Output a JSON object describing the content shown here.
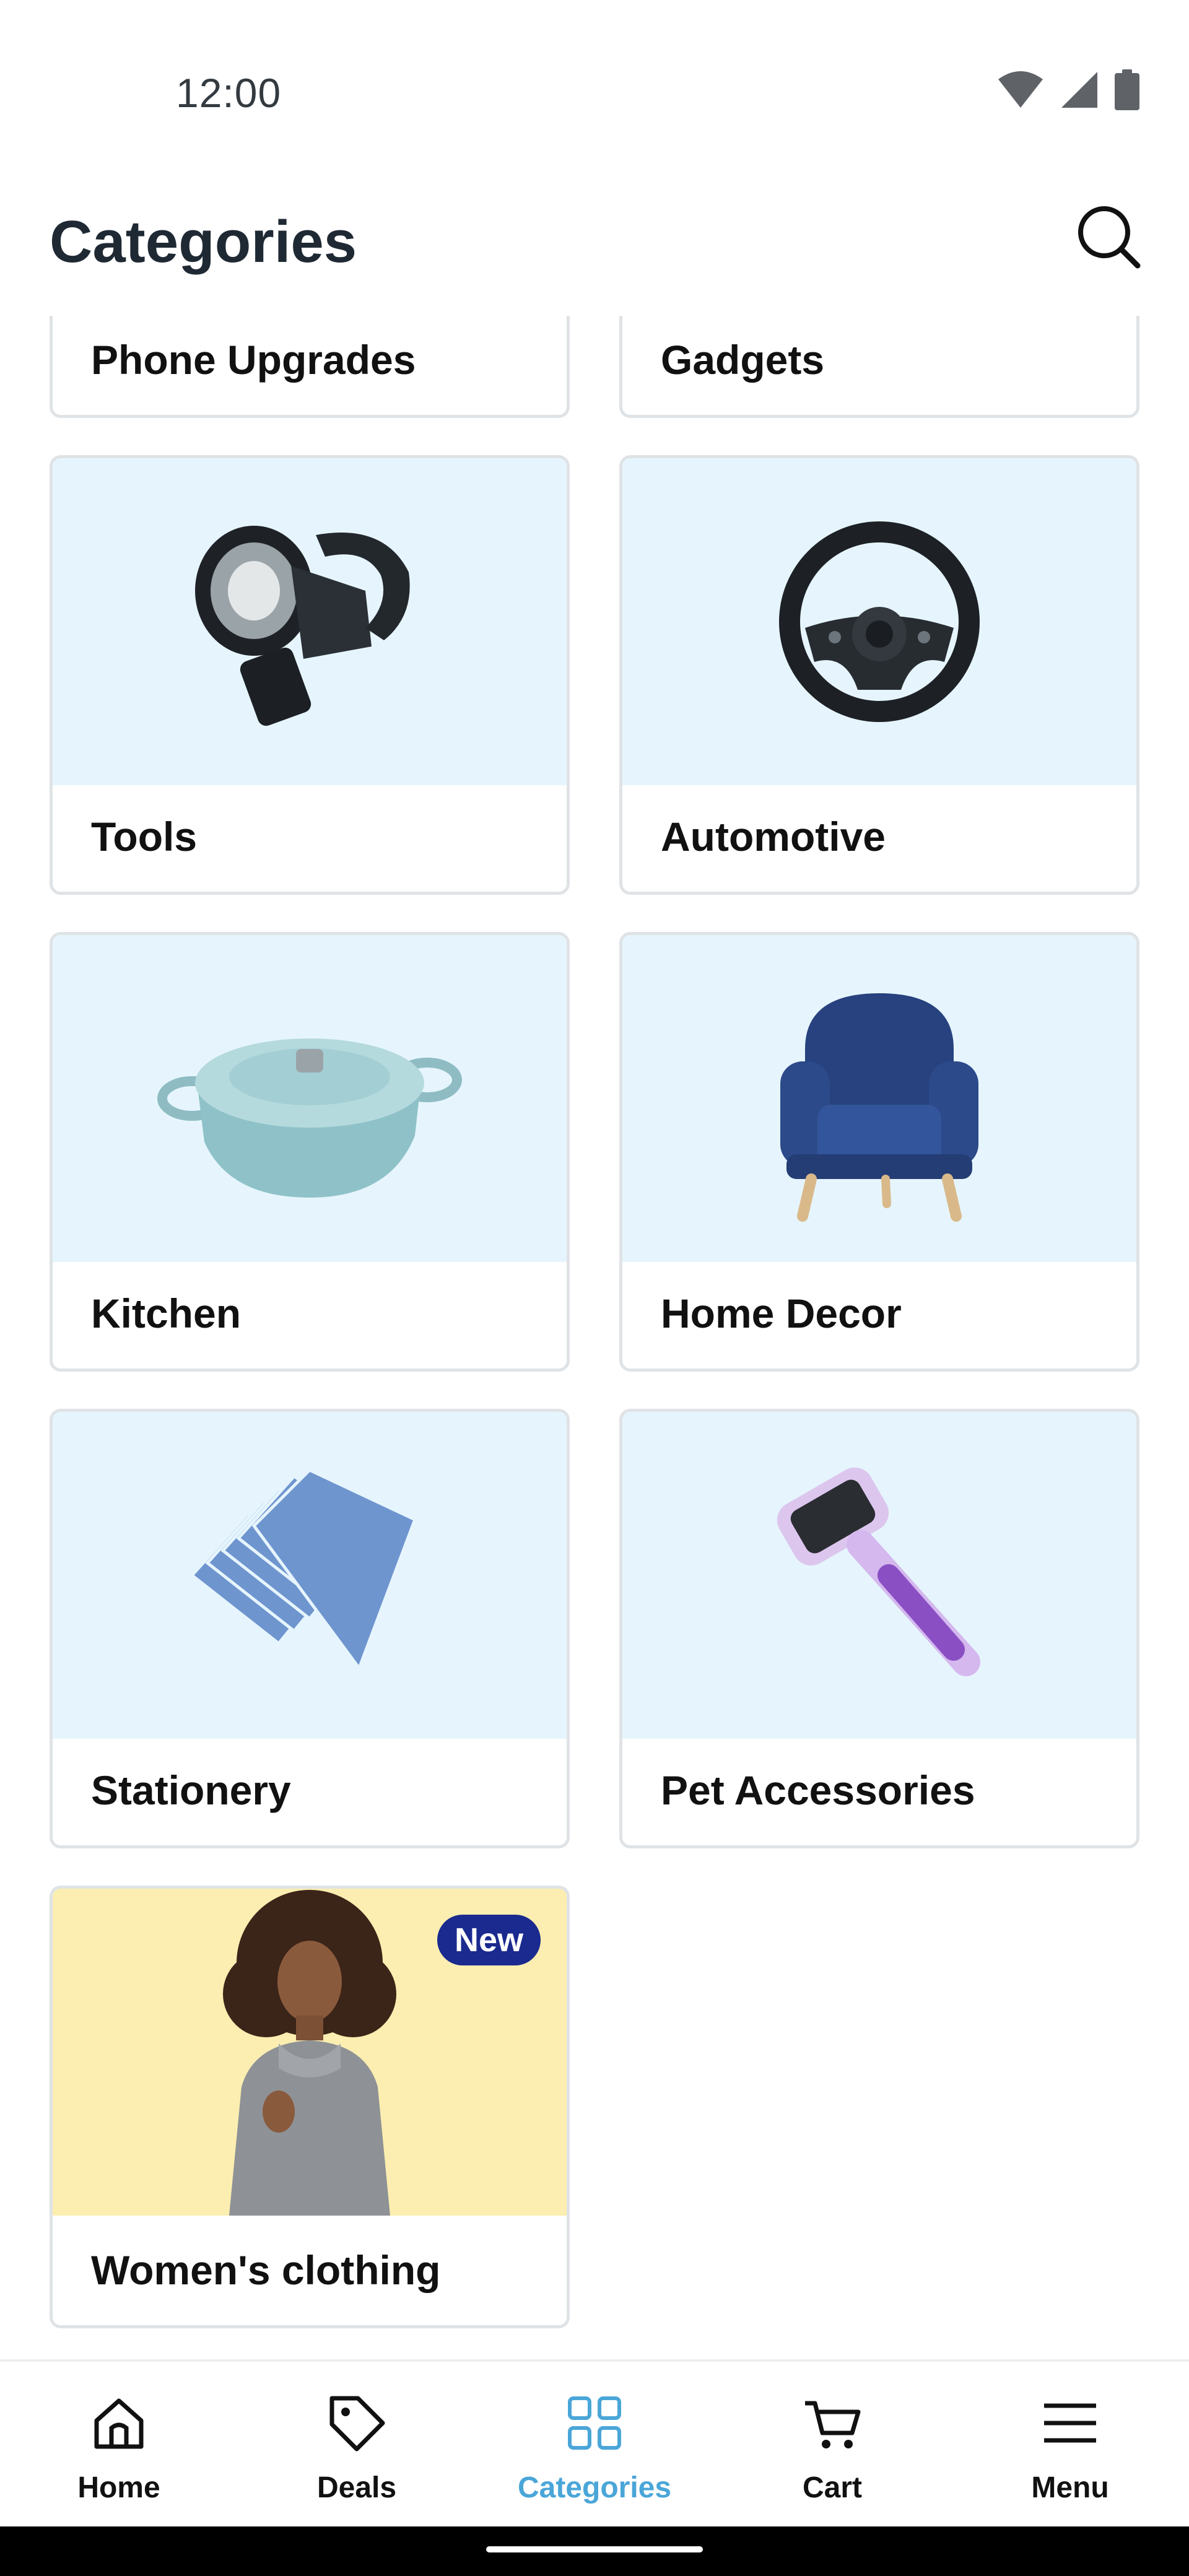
{
  "status_bar": {
    "time": "12:00",
    "icons": [
      "wifi-icon",
      "cellular-signal-icon",
      "battery-icon"
    ]
  },
  "header": {
    "title": "Categories",
    "search_icon": "search-icon"
  },
  "categories": [
    {
      "name": "Phone Upgrades",
      "image": "phone-upgrades-image"
    },
    {
      "name": "Gadgets",
      "image": "gadgets-image"
    },
    {
      "name": "Tools",
      "image": "flashlight-image"
    },
    {
      "name": "Automotive",
      "image": "steering-wheel-image"
    },
    {
      "name": "Kitchen",
      "image": "cooking-pot-image"
    },
    {
      "name": "Home Decor",
      "image": "armchair-image"
    },
    {
      "name": "Stationery",
      "image": "notebooks-image"
    },
    {
      "name": "Pet Accessories",
      "image": "pet-brush-image"
    },
    {
      "name": "Women's clothing",
      "image": "woman-sweater-image",
      "badge": "New"
    }
  ],
  "bottom_nav": {
    "items": [
      {
        "label": "Home",
        "icon": "home-icon"
      },
      {
        "label": "Deals",
        "icon": "tag-icon"
      },
      {
        "label": "Categories",
        "icon": "grid-icon",
        "active": true
      },
      {
        "label": "Cart",
        "icon": "cart-icon"
      },
      {
        "label": "Menu",
        "icon": "menu-icon"
      }
    ]
  },
  "colors": {
    "accent": "#4aa6d8",
    "card_image_bg": "#e6f5fd",
    "clothing_bg": "#fbeeb0",
    "badge_bg": "#1b2a8f",
    "card_border": "#dfe3e6"
  }
}
